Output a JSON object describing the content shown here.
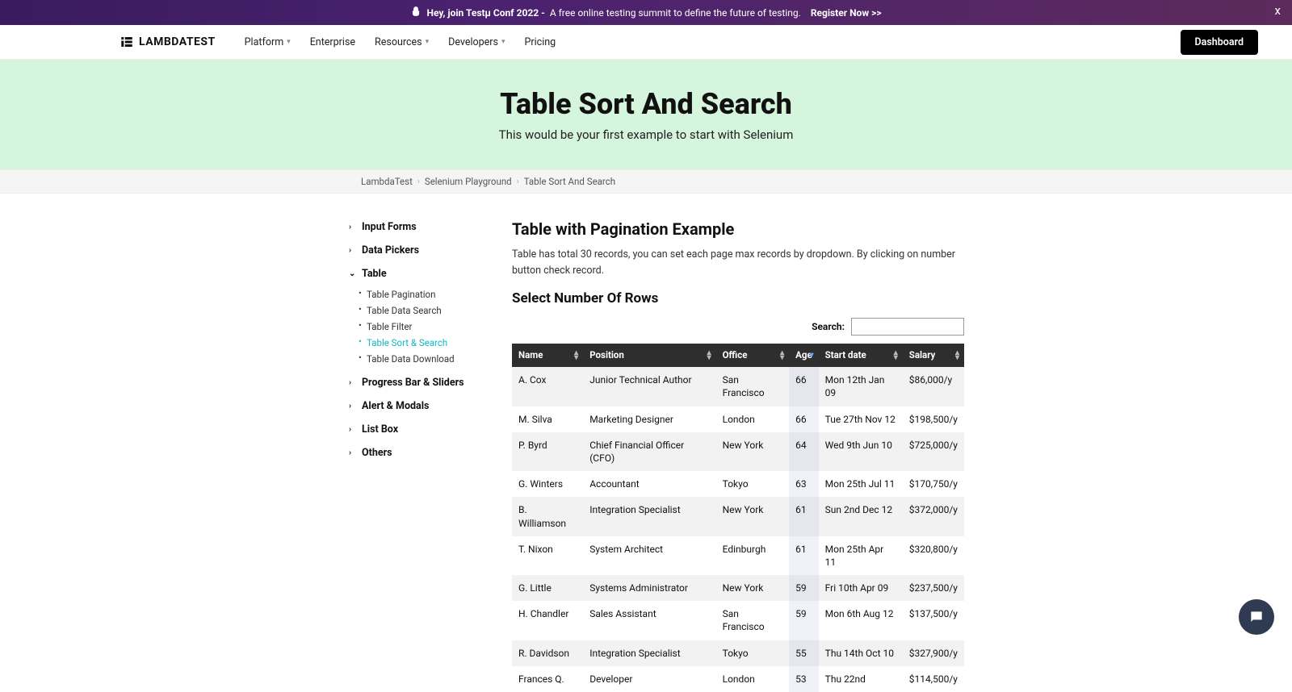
{
  "announcement": {
    "prefix": "Hey, join Testμ Conf 2022 - ",
    "mid": "A free online testing summit to define the future of testing.",
    "cta": "Register Now >>",
    "close": "x"
  },
  "nav": {
    "logo": "LAMBDATEST",
    "items": [
      "Platform",
      "Enterprise",
      "Resources",
      "Developers",
      "Pricing"
    ],
    "dropdowns": [
      true,
      false,
      true,
      true,
      false
    ],
    "dashboard": "Dashboard"
  },
  "hero": {
    "title": "Table Sort And Search",
    "subtitle": "This would be your first example to start with Selenium"
  },
  "breadcrumbs": [
    "LambdaTest",
    "Selenium Playground",
    "Table Sort And Search"
  ],
  "sidebar": {
    "groups": [
      {
        "label": "Input Forms",
        "open": false
      },
      {
        "label": "Data Pickers",
        "open": false
      },
      {
        "label": "Table",
        "open": true,
        "items": [
          {
            "label": "Table Pagination",
            "active": false
          },
          {
            "label": "Table Data Search",
            "active": false
          },
          {
            "label": "Table Filter",
            "active": false
          },
          {
            "label": "Table Sort & Search",
            "active": true
          },
          {
            "label": "Table Data Download",
            "active": false
          }
        ]
      },
      {
        "label": "Progress Bar & Sliders",
        "open": false
      },
      {
        "label": "Alert & Modals",
        "open": false
      },
      {
        "label": "List Box",
        "open": false
      },
      {
        "label": "Others",
        "open": false
      }
    ]
  },
  "content": {
    "heading": "Table with Pagination Example",
    "desc": "Table has total 30 records, you can set each page max records by dropdown. By clicking on number button check record.",
    "rows_heading": "Select Number Of Rows",
    "search_label": "Search:"
  },
  "table": {
    "columns": [
      "Name",
      "Position",
      "Office",
      "Age",
      "Start date",
      "Salary"
    ],
    "sorted_col": 3,
    "rows": [
      {
        "name": "A. Cox",
        "position": "Junior Technical Author",
        "office": "San Francisco",
        "age": "66",
        "start": "Mon 12th Jan 09",
        "salary": "$86,000/y"
      },
      {
        "name": "M. Silva",
        "position": "Marketing Designer",
        "office": "London",
        "age": "66",
        "start": "Tue 27th Nov 12",
        "salary": "$198,500/y"
      },
      {
        "name": "P. Byrd",
        "position": "Chief Financial Officer (CFO)",
        "office": "New York",
        "age": "64",
        "start": "Wed 9th Jun 10",
        "salary": "$725,000/y"
      },
      {
        "name": "G. Winters",
        "position": "Accountant",
        "office": "Tokyo",
        "age": "63",
        "start": "Mon 25th Jul 11",
        "salary": "$170,750/y"
      },
      {
        "name": "B. Williamson",
        "position": "Integration Specialist",
        "office": "New York",
        "age": "61",
        "start": "Sun 2nd Dec 12",
        "salary": "$372,000/y"
      },
      {
        "name": "T. Nixon",
        "position": "System Architect",
        "office": "Edinburgh",
        "age": "61",
        "start": "Mon 25th Apr 11",
        "salary": "$320,800/y"
      },
      {
        "name": "G. Little",
        "position": "Systems Administrator",
        "office": "New York",
        "age": "59",
        "start": "Fri 10th Apr 09",
        "salary": "$237,500/y"
      },
      {
        "name": "H. Chandler",
        "position": "Sales Assistant",
        "office": "San Francisco",
        "age": "59",
        "start": "Mon 6th Aug 12",
        "salary": "$137,500/y"
      },
      {
        "name": "R. Davidson",
        "position": "Integration Specialist",
        "office": "Tokyo",
        "age": "55",
        "start": "Thu 14th Oct 10",
        "salary": "$327,900/y"
      },
      {
        "name": "Frances Q.",
        "position": "Developer",
        "office": "London",
        "age": "53",
        "start": "Thu 22nd",
        "salary": "$114,500/y"
      }
    ]
  }
}
